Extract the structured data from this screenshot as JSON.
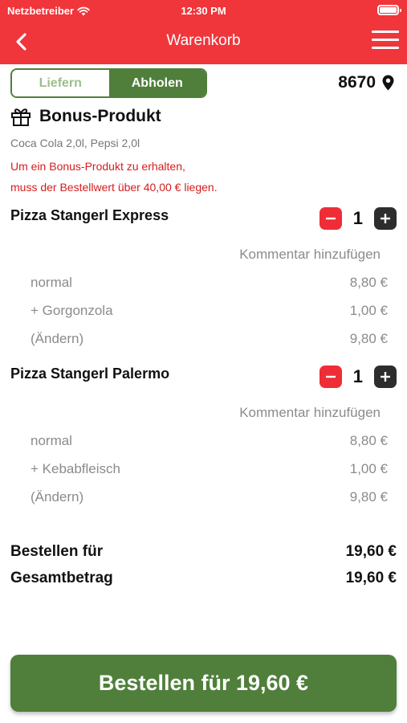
{
  "status_bar": {
    "carrier": "Netzbetreiber",
    "time": "12:30 PM"
  },
  "nav": {
    "title": "Warenkorb"
  },
  "mode_toggle": {
    "option_delivery": "Liefern",
    "option_pickup": "Abholen",
    "selected": "Abholen"
  },
  "location": {
    "zip": "8670"
  },
  "bonus": {
    "title": "Bonus-Produkt",
    "products": "Coca Cola 2,0l, Pepsi 2,0l",
    "warning_line1": "Um ein Bonus-Produkt zu erhalten,",
    "warning_line2": "muss der Bestellwert über 40,00 € liegen."
  },
  "cart_items": [
    {
      "name": "Pizza Stangerl Express",
      "quantity": "1",
      "comment_label": "Kommentar hinzufügen",
      "lines": [
        {
          "label": "normal",
          "price": "8,80 €"
        },
        {
          "label": "+ Gorgonzola",
          "price": "1,00 €"
        },
        {
          "label": "(Ändern)",
          "price": "9,80 €"
        }
      ]
    },
    {
      "name": "Pizza Stangerl Palermo",
      "quantity": "1",
      "comment_label": "Kommentar hinzufügen",
      "lines": [
        {
          "label": "normal",
          "price": "8,80 €"
        },
        {
          "label": "+ Kebabfleisch",
          "price": "1,00 €"
        },
        {
          "label": "(Ändern)",
          "price": "9,80 €"
        }
      ]
    }
  ],
  "totals": {
    "order_label": "Bestellen für",
    "order_value": "19,60 €",
    "total_label": "Gesamtbetrag",
    "total_value": "19,60 €"
  },
  "order_button": {
    "label": "Bestellen für 19,60 €"
  },
  "colors": {
    "header": "#f0353b",
    "accent_green": "#4f7f3a",
    "warning_red": "#d71c1c",
    "minus": "#ef2d36",
    "plus": "#2d2d2d"
  }
}
